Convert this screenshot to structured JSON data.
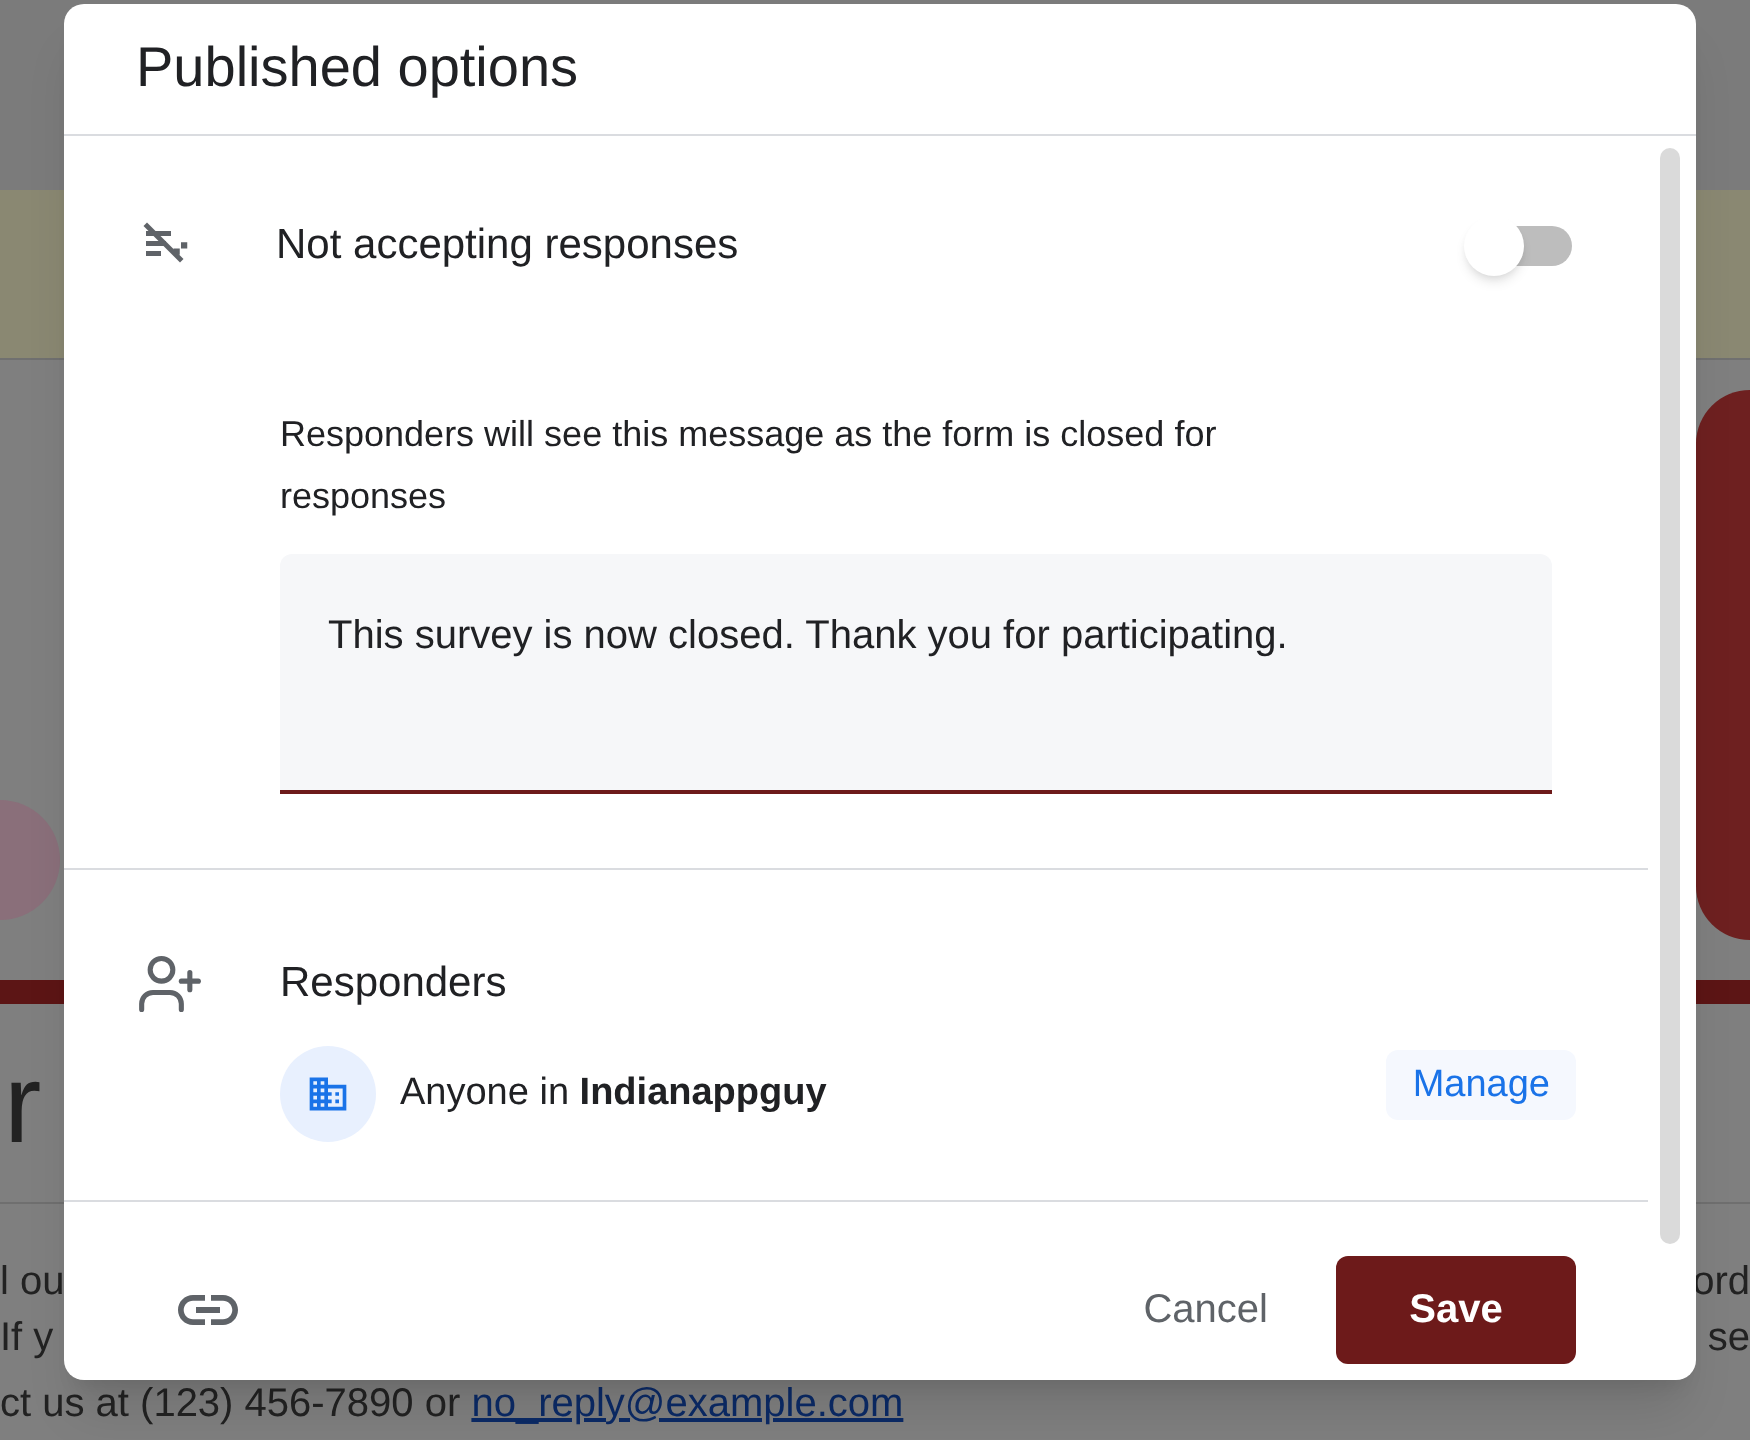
{
  "background": {
    "heading": "r",
    "lines": [
      {
        "left": "l ou",
        "right": "ord"
      },
      {
        "left": "If y",
        "right": "se"
      }
    ],
    "contact": {
      "text": "ct us at (123) 456-7890 or ",
      "link": "no_reply@example.com"
    }
  },
  "dialog": {
    "title": "Published options",
    "accepting": {
      "label": "Not accepting responses",
      "on": false,
      "message_label": "Responders will see this message as the form is closed for responses",
      "message": "This survey is now closed. Thank you for participating."
    },
    "responders": {
      "title": "Responders",
      "audience": "Anyone in **Indianappguy**",
      "manage": "Manage"
    },
    "buttons": {
      "cancel": "Cancel",
      "save": "Save"
    }
  }
}
